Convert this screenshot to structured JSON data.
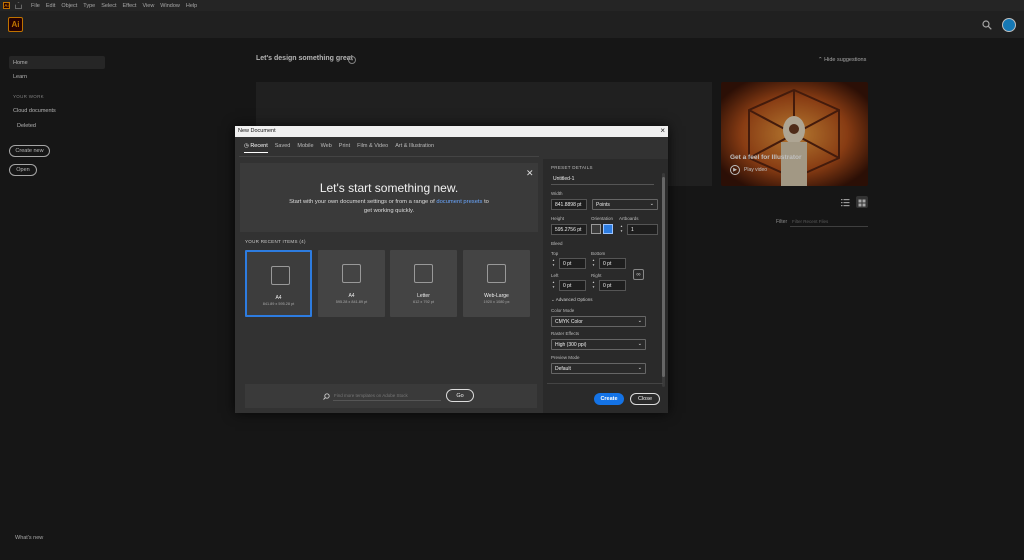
{
  "menubar": {
    "app_badge": "Ai",
    "items": [
      "File",
      "Edit",
      "Object",
      "Type",
      "Select",
      "Effect",
      "View",
      "Window",
      "Help"
    ]
  },
  "header": {
    "logo": "Ai",
    "search_icon": "search-icon",
    "avatar_icon": "avatar-icon"
  },
  "sidebar": {
    "home": "Home",
    "learn": "Learn",
    "your_work_heading": "YOUR WORK",
    "cloud_docs": "Cloud documents",
    "deleted": "Deleted",
    "create_new": "Create new",
    "open": "Open",
    "whats_new": "What's new"
  },
  "main": {
    "title": "Let's design something great",
    "info": "i",
    "hide_suggestions": "Hide suggestions",
    "promo_title": "Get a feel for Illustrator",
    "promo_play": "Play video",
    "filter_label": "Filter",
    "filter_placeholder": "Filter Recent Files"
  },
  "dialog": {
    "title": "New Document",
    "tabs": [
      "Recent",
      "Saved",
      "Mobile",
      "Web",
      "Print",
      "Film & Video",
      "Art & Illustration"
    ],
    "active_tab": "Recent",
    "banner": {
      "title": "Let's start something new.",
      "line1": "Start with your own document settings or from a range of",
      "link": "document presets",
      "line1_end": "to",
      "line2": "get working quickly."
    },
    "recent_heading": "YOUR RECENT ITEMS",
    "recent_count": "(4)",
    "recent_items": [
      {
        "name": "A4",
        "size": "841.89 x 595.28 pt"
      },
      {
        "name": "A4",
        "size": "595.28 x 841.89 pt"
      },
      {
        "name": "Letter",
        "size": "612 x 792 pt"
      },
      {
        "name": "Web-Large",
        "size": "1920 x 1080 px"
      }
    ],
    "template_placeholder": "Find more templates on Adobe Stock",
    "go": "Go",
    "preset": {
      "heading": "PRESET DETAILS",
      "name": "Untitled-1",
      "width_label": "Width",
      "width": "841.8898 pt",
      "units": "Points",
      "height_label": "Height",
      "height": "595.2756 pt",
      "orientation_label": "Orientation",
      "artboards_label": "Artboards",
      "artboards": "1",
      "bleed_label": "Bleed",
      "top_label": "Top",
      "top": "0 pt",
      "bottom_label": "Bottom",
      "bottom": "0 pt",
      "left_label": "Left",
      "left": "0 pt",
      "right_label": "Right",
      "right": "0 pt",
      "advanced": "Advanced Options",
      "color_mode_label": "Color Mode",
      "color_mode": "CMYK Color",
      "raster_label": "Raster Effects",
      "raster": "High (300 ppi)",
      "preview_label": "Preview Mode",
      "preview": "Default"
    },
    "create": "Create",
    "close": "Close"
  }
}
